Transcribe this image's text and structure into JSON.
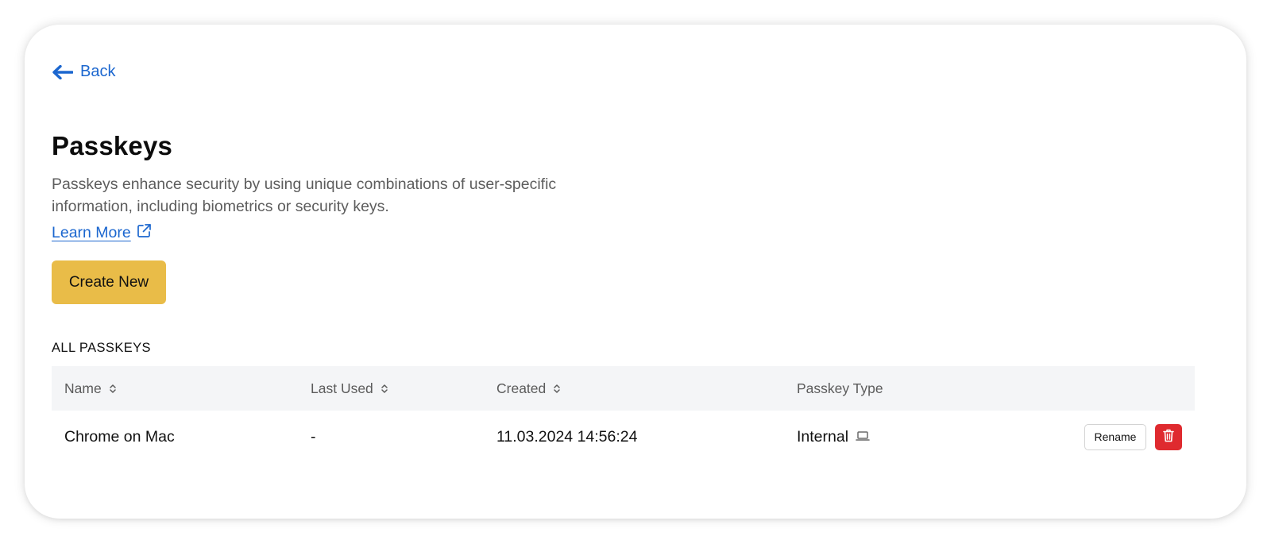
{
  "nav": {
    "back_label": "Back"
  },
  "page": {
    "title": "Passkeys",
    "description": "Passkeys enhance security by using unique combinations of user-specific information, including biometrics or security keys.",
    "learn_more_label": "Learn More",
    "create_button_label": "Create New"
  },
  "passkeys": {
    "section_label": "ALL PASSKEYS",
    "columns": [
      {
        "label": "Name",
        "sortable": true
      },
      {
        "label": "Last Used",
        "sortable": true
      },
      {
        "label": "Created",
        "sortable": true
      },
      {
        "label": "Passkey Type",
        "sortable": false
      }
    ],
    "rows": [
      {
        "name": "Chrome on Mac",
        "last_used": "-",
        "created": "11.03.2024 14:56:24",
        "type": "Internal",
        "type_icon": "laptop-icon",
        "rename_label": "Rename",
        "delete_icon": "trash-icon"
      }
    ]
  },
  "colors": {
    "link": "#1c67cf",
    "primary_button": "#e9bc48",
    "danger": "#df2a2f",
    "table_header_bg": "#f4f5f7"
  },
  "icons": {
    "back": "arrow-left-icon",
    "external_link": "external-link-icon",
    "sort": "sort-icon"
  }
}
